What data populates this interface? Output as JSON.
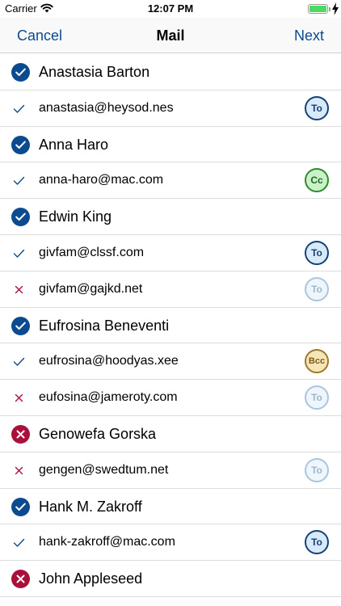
{
  "status_bar": {
    "carrier": "Carrier",
    "time": "12:07 PM"
  },
  "nav": {
    "cancel_label": "Cancel",
    "title": "Mail",
    "next_label": "Next"
  },
  "colors": {
    "accent": "#0c4a8f",
    "reject": "#a8123a"
  },
  "rows": [
    {
      "kind": "contact",
      "name": "Anastasia Barton",
      "status": "included",
      "icon": "checkmark-circle-icon"
    },
    {
      "kind": "email",
      "address": "anastasia@heysod.nes",
      "status": "included",
      "icon": "checkmark-icon",
      "badge": "To",
      "badge_style": "to"
    },
    {
      "kind": "contact",
      "name": "Anna Haro",
      "status": "included",
      "icon": "checkmark-circle-icon"
    },
    {
      "kind": "email",
      "address": "anna-haro@mac.com",
      "status": "included",
      "icon": "checkmark-icon",
      "badge": "Cc",
      "badge_style": "cc"
    },
    {
      "kind": "contact",
      "name": "Edwin King",
      "status": "included",
      "icon": "checkmark-circle-icon"
    },
    {
      "kind": "email",
      "address": "givfam@clssf.com",
      "status": "included",
      "icon": "checkmark-icon",
      "badge": "To",
      "badge_style": "to"
    },
    {
      "kind": "email",
      "address": "givfam@gajkd.net",
      "status": "excluded",
      "icon": "cross-icon",
      "badge": "To",
      "badge_style": "to-dim"
    },
    {
      "kind": "contact",
      "name": "Eufrosina Beneventi",
      "status": "included",
      "icon": "checkmark-circle-icon"
    },
    {
      "kind": "email",
      "address": "eufrosina@hoodyas.xee",
      "status": "included",
      "icon": "checkmark-icon",
      "badge": "Bcc",
      "badge_style": "bcc"
    },
    {
      "kind": "email",
      "address": "eufosina@jameroty.com",
      "status": "excluded",
      "icon": "cross-icon",
      "badge": "To",
      "badge_style": "to-dim"
    },
    {
      "kind": "contact",
      "name": "Genowefa Gorska",
      "status": "excluded",
      "icon": "cross-circle-icon"
    },
    {
      "kind": "email",
      "address": "gengen@swedtum.net",
      "status": "excluded",
      "icon": "cross-icon",
      "badge": "To",
      "badge_style": "to-dim"
    },
    {
      "kind": "contact",
      "name": "Hank M. Zakroff",
      "status": "included",
      "icon": "checkmark-circle-icon"
    },
    {
      "kind": "email",
      "address": "hank-zakroff@mac.com",
      "status": "included",
      "icon": "checkmark-icon",
      "badge": "To",
      "badge_style": "to"
    },
    {
      "kind": "contact",
      "name": "John Appleseed",
      "status": "excluded",
      "icon": "cross-circle-icon"
    }
  ]
}
